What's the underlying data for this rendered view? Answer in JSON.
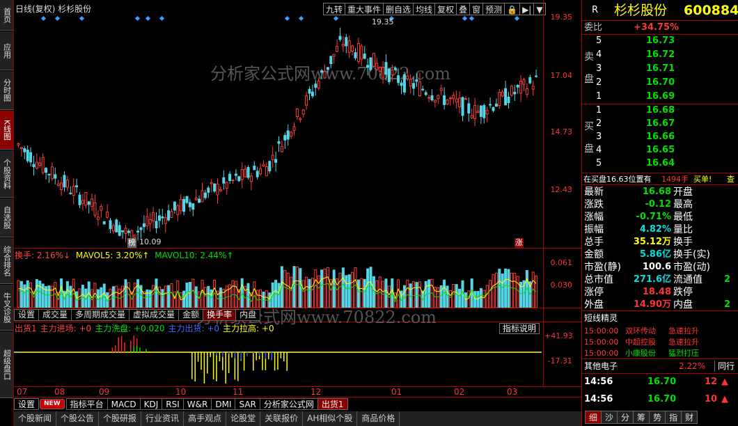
{
  "left_nav": [
    "首页",
    "应用",
    "分时图",
    "K线图",
    "个股资料",
    "自选股",
    "综合排名",
    "牛叉诊股",
    "超级盘口"
  ],
  "chart": {
    "title": "日线(复权) 杉杉股份",
    "toolbar": [
      "九转",
      "重大事件",
      "删自选",
      "均线",
      "复权",
      "叠",
      "窗",
      "预测",
      "🔒",
      "▶|",
      "▼"
    ],
    "price_axis": [
      "19.35",
      "17.04",
      "14.73",
      "12.43"
    ],
    "high_label": "19.35",
    "low_label": "10.09",
    "low_tag": "榜",
    "rise_tag": "涨",
    "watermark": "分析家公式网www.70822.com",
    "x_axis": [
      "07",
      "08",
      "09",
      "10",
      "11",
      "12",
      "01",
      "02",
      "03"
    ]
  },
  "turnover": {
    "legend": [
      {
        "t": "换手: 2.16%↓",
        "c": "#ff4444"
      },
      {
        "t": "MAVOL5: 3.20%↑",
        "c": "#ffff00"
      },
      {
        "t": "MAVOL10: 2.44%↑",
        "c": "#00e000"
      }
    ],
    "axis": [
      "0.061",
      "0.030"
    ],
    "tabs": [
      "设置",
      "成交量",
      "多周期成交量",
      "虚拟成交量",
      "金额",
      "换手率",
      "内盘"
    ],
    "active_tab": "换手率"
  },
  "indicator": {
    "legend": [
      {
        "t": "出货1",
        "c": "#ff4444"
      },
      {
        "t": "主力进场: +0",
        "c": "#ff4444"
      },
      {
        "t": "主力洗盘: +0.020",
        "c": "#00e000"
      },
      {
        "t": "主力出货: +0",
        "c": "#4466ff"
      },
      {
        "t": "主力拉高: +0",
        "c": "#ffff00"
      }
    ],
    "explain_btn": "指标说明",
    "axis": [
      "+41.93",
      "-17.31"
    ]
  },
  "bottom_tabs": [
    "设置",
    "NEW",
    "指标平台",
    "MACD",
    "KDJ",
    "RSI",
    "W&R",
    "DMI",
    "SAR",
    "分析家公式网",
    "出货1"
  ],
  "news_tabs": [
    "个股新闻",
    "个股公告",
    "个股研报",
    "行业资讯",
    "高手观点",
    "论股堂",
    "关联报价",
    "AH相似个股",
    "商品价格"
  ],
  "quote": {
    "r_badge": "R",
    "name": "杉杉股份",
    "code": "600884",
    "weibi_label": "委比",
    "weibi": "+34.75%",
    "sell_label": [
      "卖",
      "盘"
    ],
    "buy_label": [
      "买",
      "盘"
    ],
    "asks": [
      {
        "n": "5",
        "p": "16.73"
      },
      {
        "n": "4",
        "p": "16.72"
      },
      {
        "n": "3",
        "p": "16.71"
      },
      {
        "n": "2",
        "p": "16.70"
      },
      {
        "n": "1",
        "p": "16.69"
      }
    ],
    "bids": [
      {
        "n": "1",
        "p": "16.68"
      },
      {
        "n": "2",
        "p": "16.67"
      },
      {
        "n": "3",
        "p": "16.66"
      },
      {
        "n": "4",
        "p": "16.65"
      },
      {
        "n": "5",
        "p": "16.64"
      }
    ],
    "order_msg": "在买盘16.63位置有",
    "order_qty": "1494手",
    "order_type": "买单!",
    "order_extra": "查",
    "stats": [
      {
        "l": "最新",
        "v": "16.68",
        "vc": "g",
        "l2": "开盘"
      },
      {
        "l": "涨跌",
        "v": "-0.12",
        "vc": "g",
        "l2": "最高"
      },
      {
        "l": "涨幅",
        "v": "-0.71%",
        "vc": "g",
        "l2": "最低"
      },
      {
        "l": "振幅",
        "v": "4.82%",
        "vc": "c",
        "l2": "量比"
      },
      {
        "l": "总手",
        "v": "35.12万",
        "vc": "y",
        "l2": "换手"
      },
      {
        "l": "金额",
        "v": "5.86亿",
        "vc": "c",
        "l2": "换手(实)"
      },
      {
        "l": "市盈(静)",
        "v": "100.6",
        "vc": "w",
        "l2": "市盈(动)"
      },
      {
        "l": "总市值",
        "v": "271.6亿",
        "vc": "c",
        "l2": "流通值",
        "v2": "2"
      },
      {
        "l": "涨停",
        "v": "18.48",
        "vc": "red",
        "l2": "跌停"
      },
      {
        "l": "外盘",
        "v": "14.90万",
        "vc": "red",
        "l2": "内盘",
        "v2": "2"
      }
    ],
    "short_title": "短线精灵",
    "short_list": [
      {
        "t": "15:00:00",
        "n": "双环传动",
        "e": "急速拉升",
        "nc": "red",
        "ec": "red"
      },
      {
        "t": "15:00:00",
        "n": "中超控股",
        "e": "急速拉升",
        "nc": "red",
        "ec": "red"
      },
      {
        "t": "15:00:00",
        "n": "小康股份",
        "e": "猛烈打压",
        "nc": "g",
        "ec": "g"
      }
    ],
    "sector": "其他电子",
    "sector_pct": "2.22%",
    "sector_same": "同行",
    "ticks": [
      {
        "t": "14:56",
        "p": "16.70",
        "v": "12"
      },
      {
        "t": "14:56",
        "p": "16.70",
        "v": "10"
      }
    ],
    "bottom_tabs": [
      "细",
      "沙",
      "分",
      "筹",
      "势",
      "指",
      "财"
    ]
  }
}
